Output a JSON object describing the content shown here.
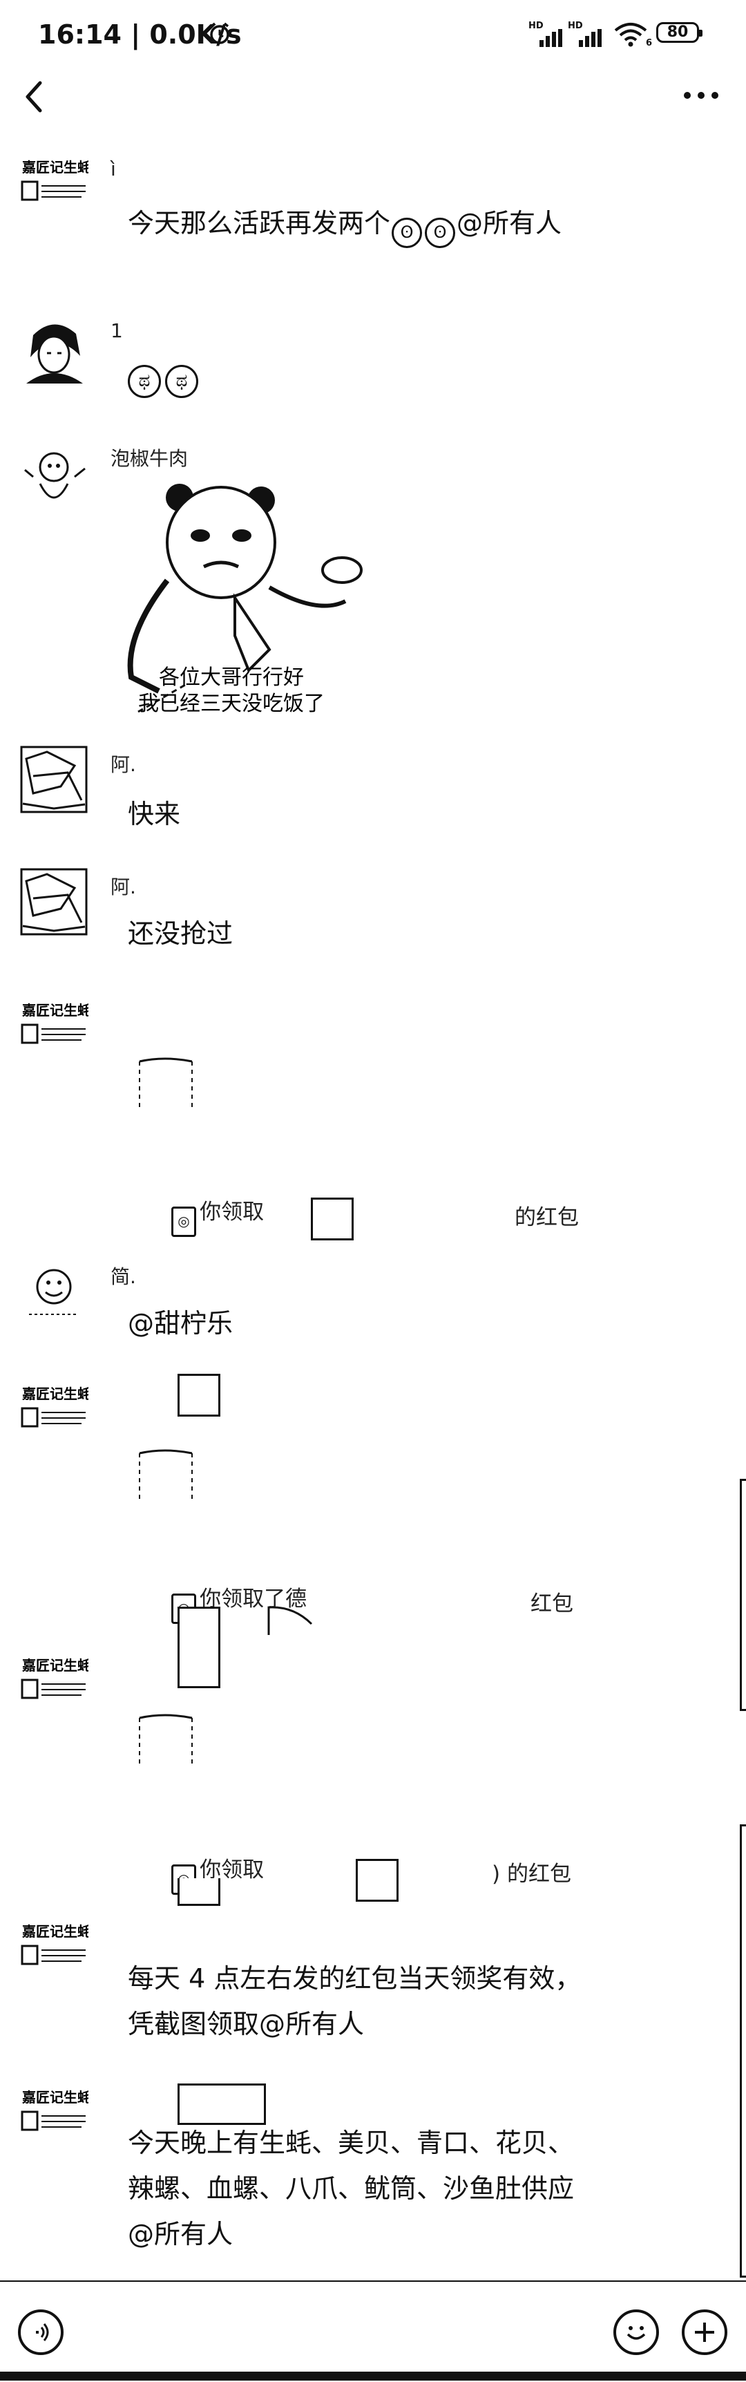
{
  "status_bar": {
    "time": "16:14",
    "speed": "0.0K/s",
    "sig1_label": "HD",
    "sig2_label": "HD",
    "wifi_badge": "6",
    "battery": "80"
  },
  "nav": {
    "back_icon": "chevron-left-icon",
    "more_icon": "ellipsis-icon"
  },
  "messages": [
    {
      "sender": "ì",
      "text": "今天那么活跃再发两个",
      "mention": "@所有人"
    },
    {
      "sender": "1"
    },
    {
      "sender": "泡椒牛肉",
      "sticker_caption_1": "各位大哥行行好",
      "sticker_caption_2": "我已经三天没吃饭了"
    },
    {
      "sender": "阿.",
      "text": "快来"
    },
    {
      "sender": "阿.",
      "text": "还没抢过"
    },
    {
      "redpacket_prefix": "你领取",
      "redpacket_suffix": "的红包"
    },
    {
      "sender": "简.",
      "text": "@甜柠乐"
    },
    {
      "redpacket_prefix": "你领取了德",
      "redpacket_suffix": "红包"
    },
    {
      "redpacket_prefix": "你领取",
      "redpacket_suffix": ") 的红包"
    },
    {
      "text_line1": "每天 4 点左右发的红包当天领奖有效，",
      "text_line2": "凭截图领取@所有人"
    },
    {
      "text_line1": "今天晚上有生蚝、美贝、青口、花贝、",
      "text_line2": "辣螺、血螺、八爪、鱿筒、沙鱼肚供应",
      "text_line3": "@所有人"
    }
  ],
  "bottom_bar": {
    "voice_icon": "voice-icon",
    "emoji_icon": "emoji-icon",
    "plus_icon": "plus-icon"
  }
}
